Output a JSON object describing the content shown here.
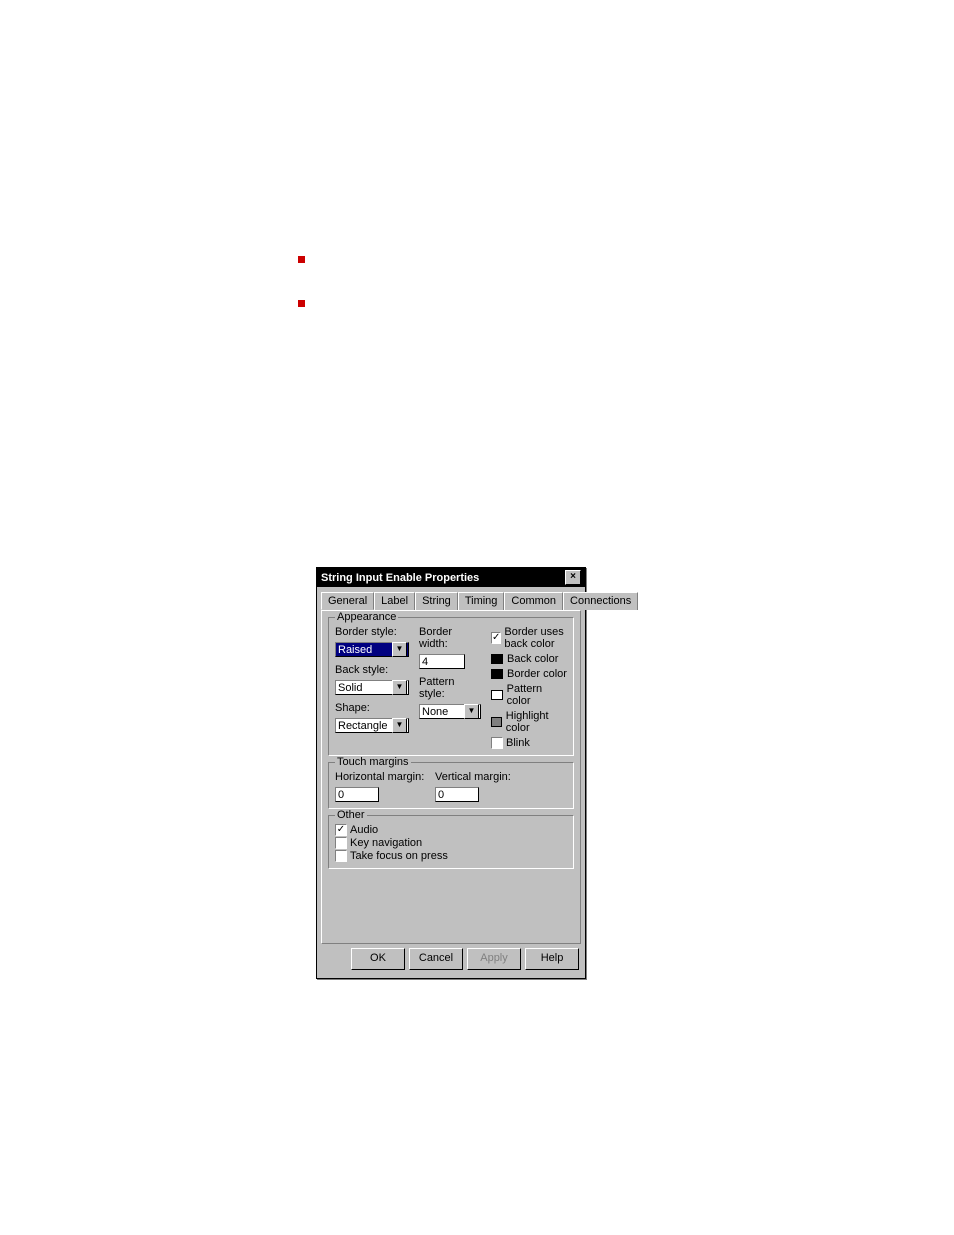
{
  "bullets": [
    "",
    ""
  ],
  "dialog": {
    "title": "String Input Enable Properties",
    "close_glyph": "×",
    "tabs": [
      "General",
      "Label",
      "String",
      "Timing",
      "Common",
      "Connections"
    ],
    "active_tab": 0,
    "appearance": {
      "legend": "Appearance",
      "border_style": {
        "label": "Border style:",
        "value": "Raised"
      },
      "border_width": {
        "label": "Border width:",
        "value": "4"
      },
      "back_style": {
        "label": "Back style:",
        "value": "Solid"
      },
      "pattern_style": {
        "label": "Pattern style:",
        "value": "None"
      },
      "shape": {
        "label": "Shape:",
        "value": "Rectangle"
      },
      "border_uses_back": {
        "label": "Border uses back color",
        "checked": true
      },
      "back_color": {
        "label": "Back color",
        "hex": "#000000"
      },
      "border_color": {
        "label": "Border color",
        "hex": "#000000"
      },
      "pattern_color": {
        "label": "Pattern color",
        "hex": "#ffffff"
      },
      "highlight_color": {
        "label": "Highlight color",
        "hex": "#808080"
      },
      "blink": {
        "label": "Blink",
        "checked": false
      }
    },
    "touch": {
      "legend": "Touch margins",
      "horizontal": {
        "label": "Horizontal margin:",
        "value": "0"
      },
      "vertical": {
        "label": "Vertical margin:",
        "value": "0"
      }
    },
    "other": {
      "legend": "Other",
      "audio": {
        "label": "Audio",
        "checked": true
      },
      "keynav": {
        "label": "Key navigation",
        "checked": false
      },
      "focus": {
        "label": "Take focus on press",
        "checked": false
      }
    },
    "buttons": {
      "ok": "OK",
      "cancel": "Cancel",
      "apply": "Apply",
      "help": "Help"
    }
  }
}
